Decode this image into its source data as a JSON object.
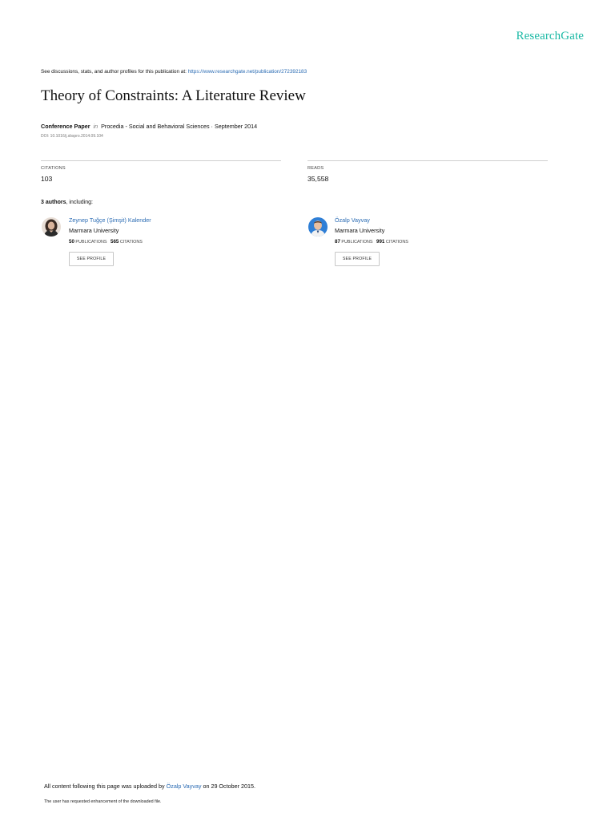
{
  "brand": {
    "logo_text": "ResearchGate",
    "accent": "#1bb9a5",
    "link_color": "#2a6bb3"
  },
  "header": {
    "discussion_text": "See discussions, stats, and author profiles for this publication at: ",
    "publication_url": "https://www.researchgate.net/publication/272392183"
  },
  "paper": {
    "title": "Theory of Constraints: A Literature Review",
    "type": "Conference Paper",
    "in_label": "in",
    "venue_date": "Procedia - Social and Behavioral Sciences · September 2014",
    "doi": "DOI: 10.1016/j.sbspro.2014.09.104"
  },
  "stats": {
    "citations_label": "CITATIONS",
    "citations_value": "103",
    "reads_label": "READS",
    "reads_value": "35,558"
  },
  "authors": {
    "count_bold": "3 authors",
    "count_rest": ", including:",
    "list": [
      {
        "name": "Zeynep Tuğçe (Şimşit) Kalender",
        "institution": "Marmara University",
        "publications_count": "50",
        "publications_label": "PUBLICATIONS",
        "citations_count": "565",
        "citations_label": "CITATIONS",
        "button_label": "SEE PROFILE"
      },
      {
        "name": "Özalp Vayvay",
        "institution": "Marmara University",
        "publications_count": "87",
        "publications_label": "PUBLICATIONS",
        "citations_count": "991",
        "citations_label": "CITATIONS",
        "button_label": "SEE PROFILE"
      }
    ]
  },
  "footer": {
    "uploaded_prefix": "All content following this page was uploaded by ",
    "uploaded_by": "Özalp Vayvay",
    "uploaded_suffix": " on 29 October 2015.",
    "enhancement_note": "The user has requested enhancement of the downloaded file."
  }
}
